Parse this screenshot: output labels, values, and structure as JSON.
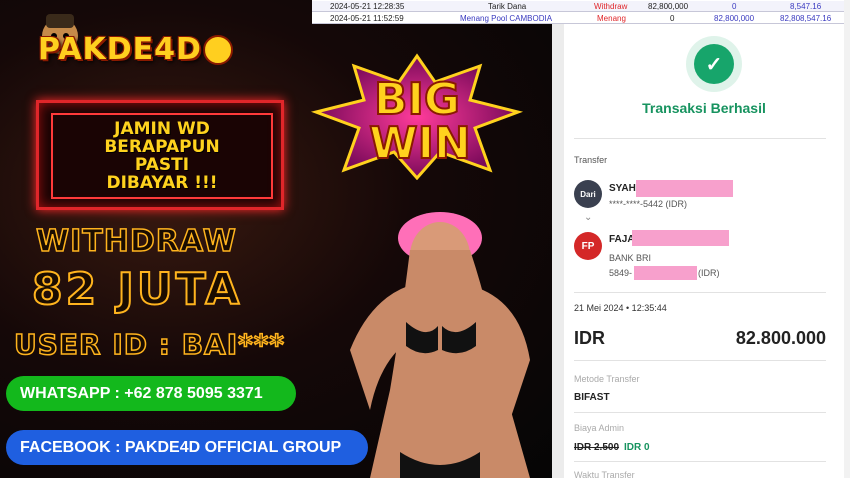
{
  "brand": {
    "logo_text": "PAKDE4D"
  },
  "promo": {
    "badge_lines": [
      "JAMIN WD",
      "BERAPAPUN",
      "PASTI",
      "DIBAYAR !!!"
    ],
    "bigwin_top": "BIG",
    "bigwin_bottom": "WIN",
    "withdraw_title": "WITHDRAW",
    "withdraw_amount": "82 JUTA",
    "user_id": "USER ID : BAI***",
    "whatsapp": "WHATSAPP : +62 878 5095 3371",
    "facebook": "FACEBOOK : PAKDE4D OFFICIAL GROUP"
  },
  "table": {
    "rows": [
      {
        "date": "2024-05-21 12:28:35",
        "desc": "Tarik Dana",
        "type": "Withdraw",
        "debit": "82,800,000",
        "credit": "0",
        "balance": "8,547.16"
      },
      {
        "date": "2024-05-21 11:52:59",
        "desc": "Menang Pool CAMBODIA",
        "type": "Menang",
        "debit": "0",
        "credit": "82,800,000",
        "balance": "82,808,547.16"
      }
    ]
  },
  "receipt": {
    "status": "Transaksi Berhasil",
    "section_transfer": "Transfer",
    "from_avatar": "Dari",
    "from_name": "SYAH",
    "from_account": "****-****-5442 (IDR)",
    "to_avatar": "FP",
    "to_name": "FAJA",
    "to_bank": "BANK BRI",
    "to_account_prefix": "5849-",
    "to_account_suffix": "(IDR)",
    "datetime": "21 Mei 2024 • 12:35:44",
    "currency": "IDR",
    "amount": "82.800.000",
    "method_label": "Metode Transfer",
    "method_value": "BIFAST",
    "fee_label": "Biaya Admin",
    "fee_old": "IDR 2.500",
    "fee_new": "IDR 0",
    "time_label": "Waktu Transfer"
  },
  "colors": {
    "success": "#17935f",
    "withdraw": "#e0262a",
    "menang": "#e0262a",
    "pool_link": "#3a3ac0",
    "whatsapp": "#13b81c",
    "facebook": "#1f5fe0"
  }
}
